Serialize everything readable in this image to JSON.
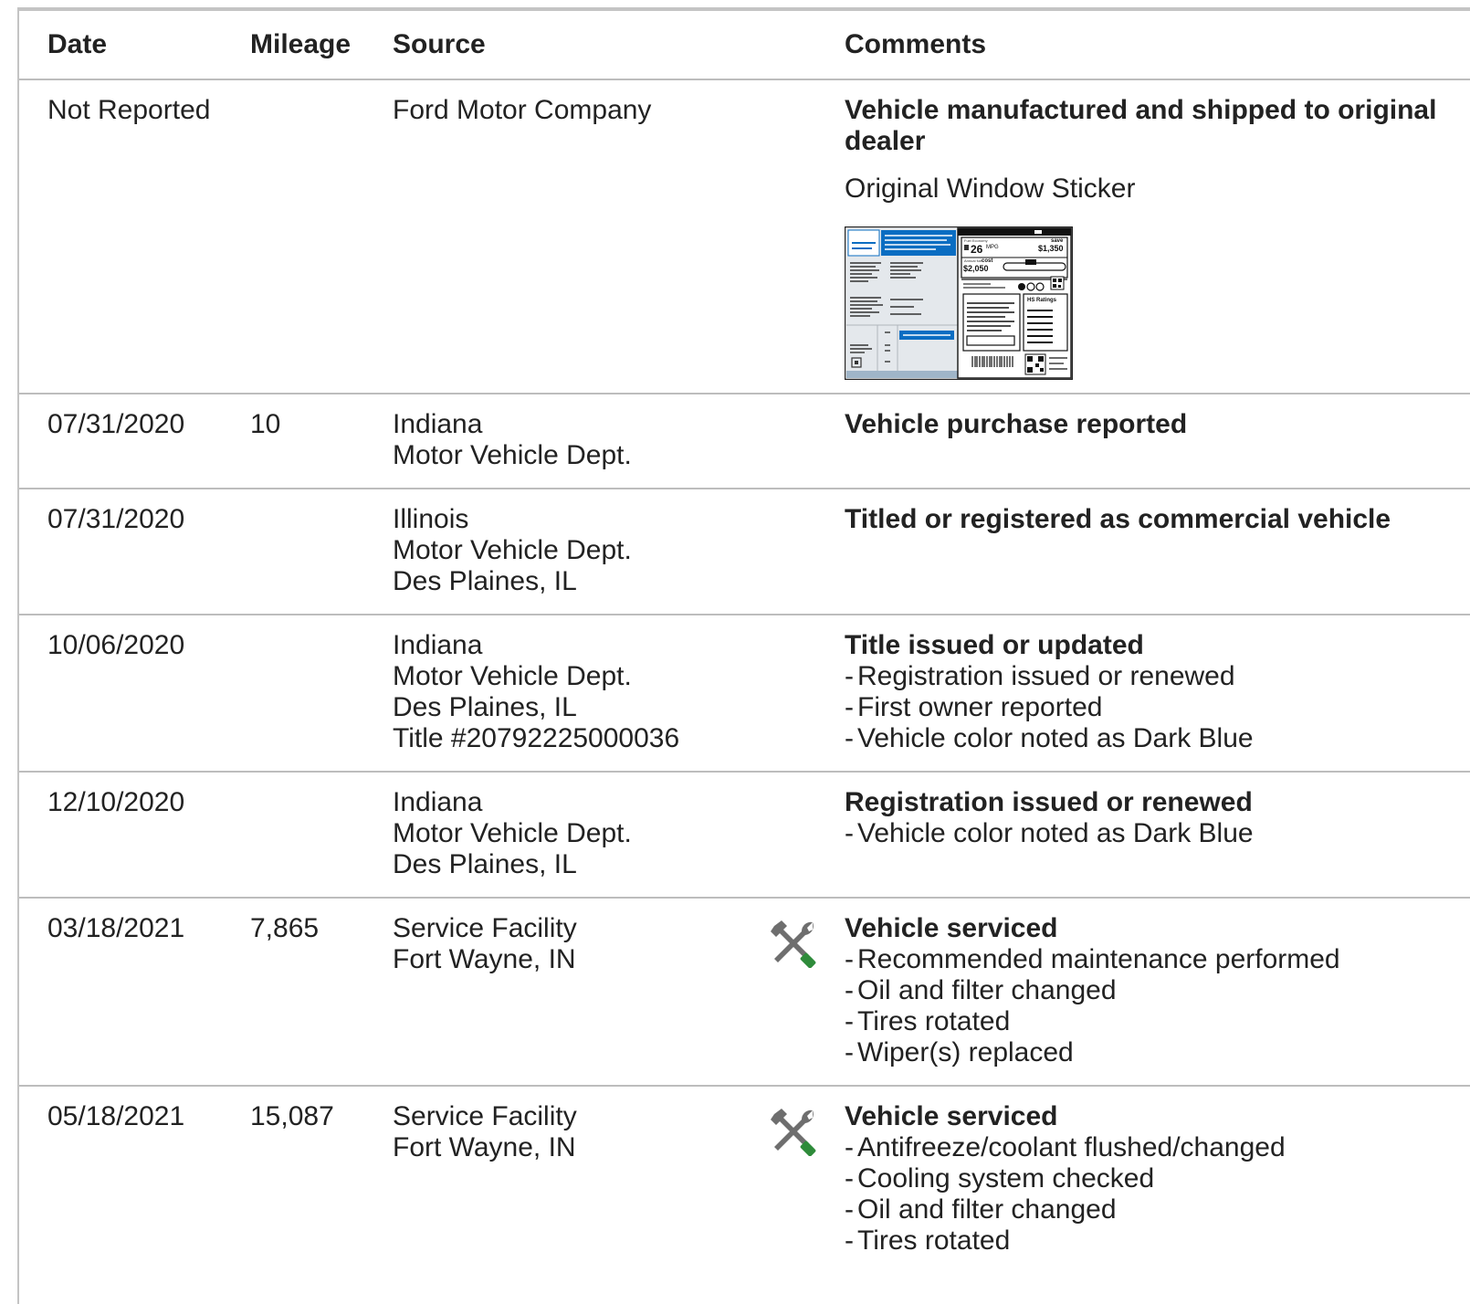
{
  "header": {
    "date": "Date",
    "mileage": "Mileage",
    "source": "Source",
    "comments": "Comments"
  },
  "sticker": {
    "label": "Original Window Sticker",
    "mpg": "26",
    "mpg_unit": "MPG",
    "save": "$1,350",
    "cost": "$2,050",
    "ratings": "HS Ratings",
    "accent": "#0a6dc2"
  },
  "icons": {
    "service": "wrench-screwdriver-icon",
    "service_accent": "#2e8b3a"
  },
  "rows": [
    {
      "date": "Not Reported",
      "mileage": "",
      "source": [
        "Ford Motor Company"
      ],
      "title": "Vehicle manufactured and shipped to original dealer",
      "details": []
    },
    {
      "date": "07/31/2020",
      "mileage": "10",
      "source": [
        "Indiana",
        "Motor Vehicle Dept."
      ],
      "title": "Vehicle purchase reported",
      "details": []
    },
    {
      "date": "07/31/2020",
      "mileage": "",
      "source": [
        "Illinois",
        "Motor Vehicle Dept.",
        "Des Plaines, IL"
      ],
      "title": "Titled or registered as commercial vehicle",
      "details": []
    },
    {
      "date": "10/06/2020",
      "mileage": "",
      "source": [
        "Indiana",
        "Motor Vehicle Dept.",
        "Des Plaines, IL",
        "Title #20792225000036"
      ],
      "title": "Title issued or updated",
      "details": [
        "Registration issued or renewed",
        "First owner reported",
        "Vehicle color noted as Dark Blue"
      ]
    },
    {
      "date": "12/10/2020",
      "mileage": "",
      "source": [
        "Indiana",
        "Motor Vehicle Dept.",
        "Des Plaines, IL"
      ],
      "title": "Registration issued or renewed",
      "details": [
        "Vehicle color noted as Dark Blue"
      ]
    },
    {
      "date": "03/18/2021",
      "mileage": "7,865",
      "source": [
        "Service Facility",
        "Fort Wayne, IN"
      ],
      "title": "Vehicle serviced",
      "details": [
        "Recommended maintenance performed",
        "Oil and filter changed",
        "Tires rotated",
        "Wiper(s) replaced"
      ]
    },
    {
      "date": "05/18/2021",
      "mileage": "15,087",
      "source": [
        "Service Facility",
        "Fort Wayne, IN"
      ],
      "title": "Vehicle serviced",
      "details": [
        "Antifreeze/coolant flushed/changed",
        "Cooling system checked",
        "Oil and filter changed",
        "Tires rotated"
      ]
    }
  ]
}
